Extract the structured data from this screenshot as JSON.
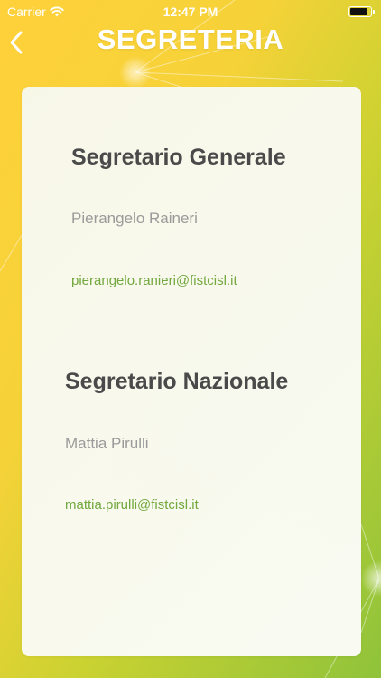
{
  "status_bar": {
    "carrier": "Carrier",
    "time": "12:47 PM",
    "icons": [
      "wifi-icon",
      "battery-icon"
    ]
  },
  "nav": {
    "title": "SEGRETERIA",
    "back_icon": "chevron-left-icon"
  },
  "sections": [
    {
      "title": "Segretario Generale",
      "name": "Pierangelo Raineri",
      "email": "pierangelo.ranieri@fistcisl.it"
    },
    {
      "title": "Segretario Nazionale",
      "name": "Mattia Pirulli",
      "email": "mattia.pirulli@fistcisl.it"
    }
  ],
  "colors": {
    "background_start": "#ffd13a",
    "background_end": "#8fc33b",
    "title_text": "#4a4a4a",
    "name_text": "#9a9a9a",
    "email_text": "#72a83e",
    "nav_text": "#ffffff"
  }
}
